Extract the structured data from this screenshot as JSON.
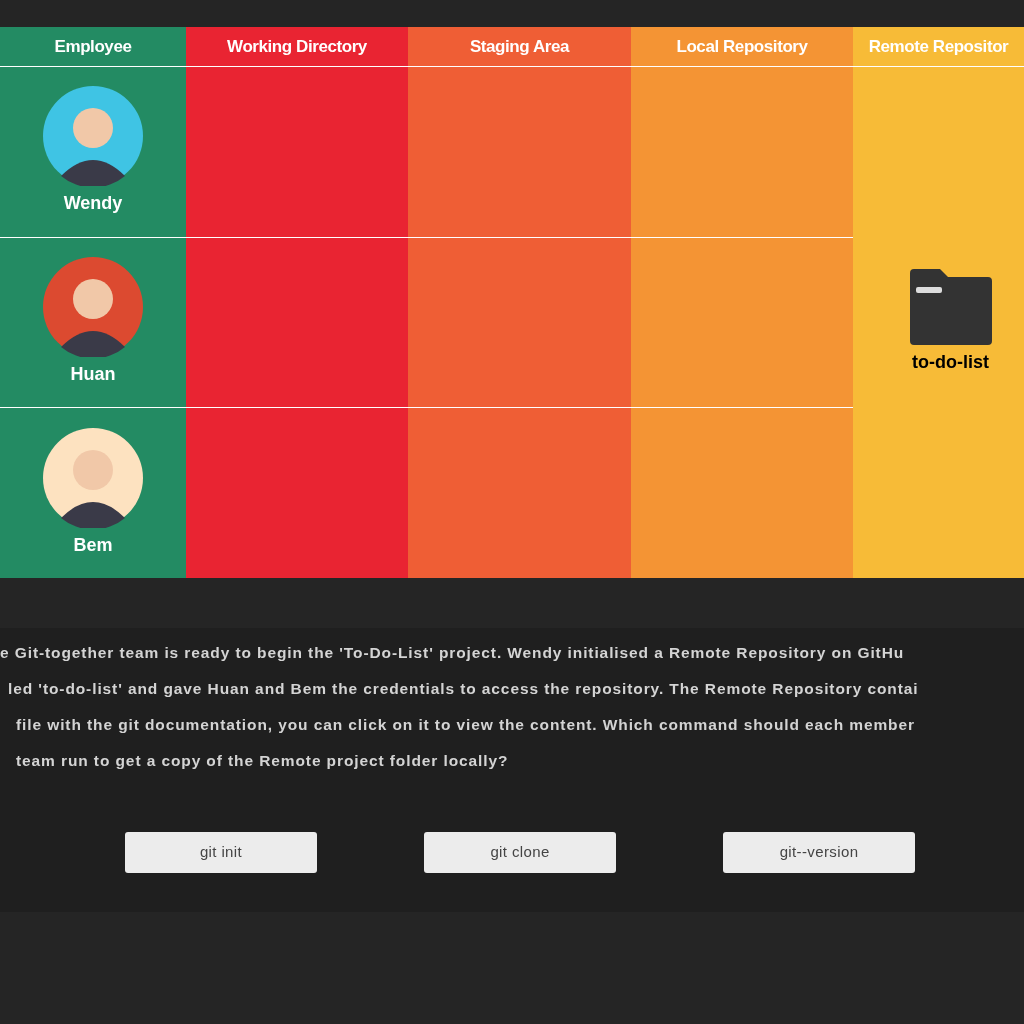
{
  "columns": [
    {
      "label": "Employee"
    },
    {
      "label": "Working Directory"
    },
    {
      "label": "Staging Area"
    },
    {
      "label": "Local Repository"
    },
    {
      "label": "Remote Repositor"
    }
  ],
  "employees": [
    {
      "name": "Wendy",
      "color": "#3fc4e4"
    },
    {
      "name": "Huan",
      "color": "#dc4a30"
    },
    {
      "name": "Bem",
      "color": "#fde2c0"
    }
  ],
  "remote": {
    "folder": "to-do-list"
  },
  "question_lines": [
    "e Git-together team is ready to begin the 'To-Do-List' project. Wendy initialised a Remote Repository on GitHu",
    "led 'to-do-list' and gave Huan and Bem the credentials to access the repository. The Remote Repository contai",
    "file with the git documentation, you can click on it to view the content. Which command should each member",
    "team run to get a copy of the Remote project folder locally?"
  ],
  "answers": [
    "git init",
    "git clone",
    "git--version"
  ]
}
